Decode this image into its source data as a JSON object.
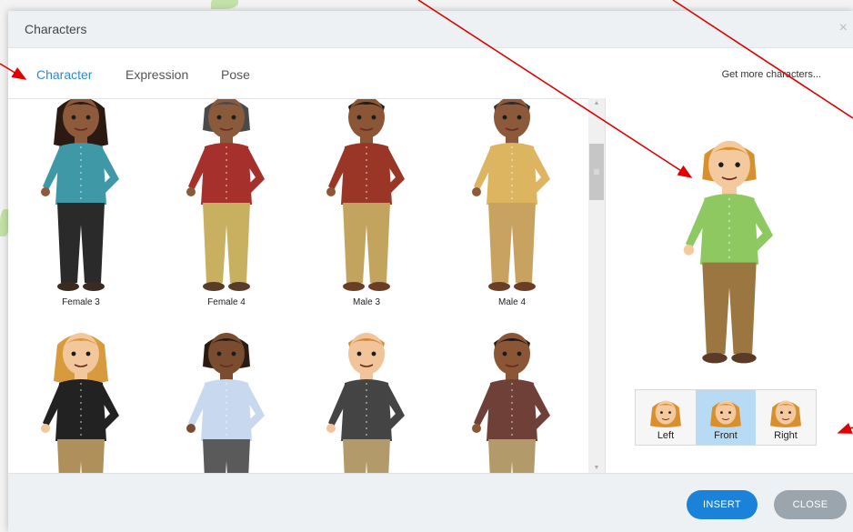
{
  "dialog": {
    "title": "Characters",
    "close_icon": "close-icon"
  },
  "tabs": [
    {
      "label": "Character",
      "active": true
    },
    {
      "label": "Expression",
      "active": false
    },
    {
      "label": "Pose",
      "active": false
    }
  ],
  "more_link": "Get more characters...",
  "gallery": {
    "characters": [
      {
        "label": "Female 3",
        "skin": "#8d5a3b",
        "hair": "#2b1a12",
        "top": "#3e98a6",
        "bottom": "#2a2a2a",
        "hairstyle": "long",
        "shoes": "#3a2a20"
      },
      {
        "label": "Female 4",
        "skin": "#8a5a3c",
        "hair": "#4a4a4a",
        "top": "#a6302c",
        "bottom": "#c8b060",
        "hairstyle": "bob",
        "shoes": "#5a3b28"
      },
      {
        "label": "Male 3",
        "skin": "#8a5636",
        "hair": "#1f1a16",
        "top": "#9a3626",
        "bottom": "#c2a45e",
        "hairstyle": "short",
        "shoes": "#6a3e24"
      },
      {
        "label": "Male 4",
        "skin": "#8c5a3a",
        "hair": "#2a2a2a",
        "top": "#ddb561",
        "bottom": "#c7a260",
        "hairstyle": "short",
        "shoes": "#6a3e24"
      },
      {
        "label": "",
        "skin": "#f2c79c",
        "hair": "#d79a3c",
        "top": "#222222",
        "bottom": "#b0905a",
        "hairstyle": "long",
        "shoes": "#4a3020"
      },
      {
        "label": "",
        "skin": "#7a4d30",
        "hair": "#2b1a12",
        "top": "#c8d8ee",
        "bottom": "#5a5a5a",
        "hairstyle": "bob",
        "shoes": "#333"
      },
      {
        "label": "",
        "skin": "#f1c49a",
        "hair": "#d08a3a",
        "top": "#444444",
        "bottom": "#b29a6a",
        "hairstyle": "short",
        "shoes": "#4a3020"
      },
      {
        "label": "",
        "skin": "#8a5636",
        "hair": "#1f1a16",
        "top": "#6e4038",
        "bottom": "#b29a6a",
        "hairstyle": "short",
        "shoes": "#4a3020"
      }
    ]
  },
  "preview": {
    "skin": "#f4c99e",
    "hair": "#d8902e",
    "top": "#8ec860",
    "bottom": "#9b7640",
    "shoes": "#5a3b28"
  },
  "views": [
    {
      "label": "Left",
      "active": false
    },
    {
      "label": "Front",
      "active": true
    },
    {
      "label": "Right",
      "active": false
    }
  ],
  "footer": {
    "insert_label": "INSERT",
    "close_label": "CLOSE"
  },
  "colors": {
    "accent": "#1a82d9",
    "tab_active": "#2e8bd6",
    "annotation_arrow": "#e00000"
  }
}
